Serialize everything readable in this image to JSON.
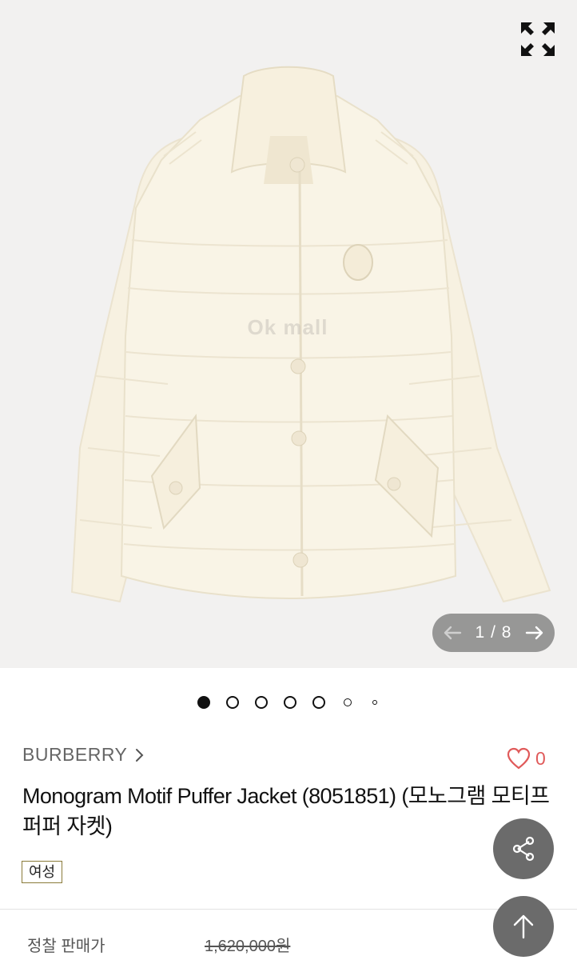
{
  "gallery": {
    "watermark": "Ok mall",
    "current_page": "1",
    "separator": "/",
    "total_pages": "8",
    "dots_count": 7,
    "active_dot": 0
  },
  "product": {
    "brand": "BURBERRY",
    "like_count": "0",
    "title": "Monogram Motif Puffer Jacket (8051851) (모노그램 모티프 퍼퍼 자켓)",
    "tag": "여성",
    "list_price_label": "정찰 판매가",
    "list_price": "1,620,000원"
  },
  "icons": {
    "expand": "expand-icon",
    "prev": "arrow-left-icon",
    "next": "arrow-right-icon",
    "brand_link": "chevron-right-icon",
    "like": "heart-icon",
    "share": "share-icon",
    "top": "arrow-up-icon"
  },
  "colors": {
    "like_accent": "#e05a5a",
    "fab_bg": "#6b6b6b",
    "gallery_bg": "#f2f1f0"
  }
}
